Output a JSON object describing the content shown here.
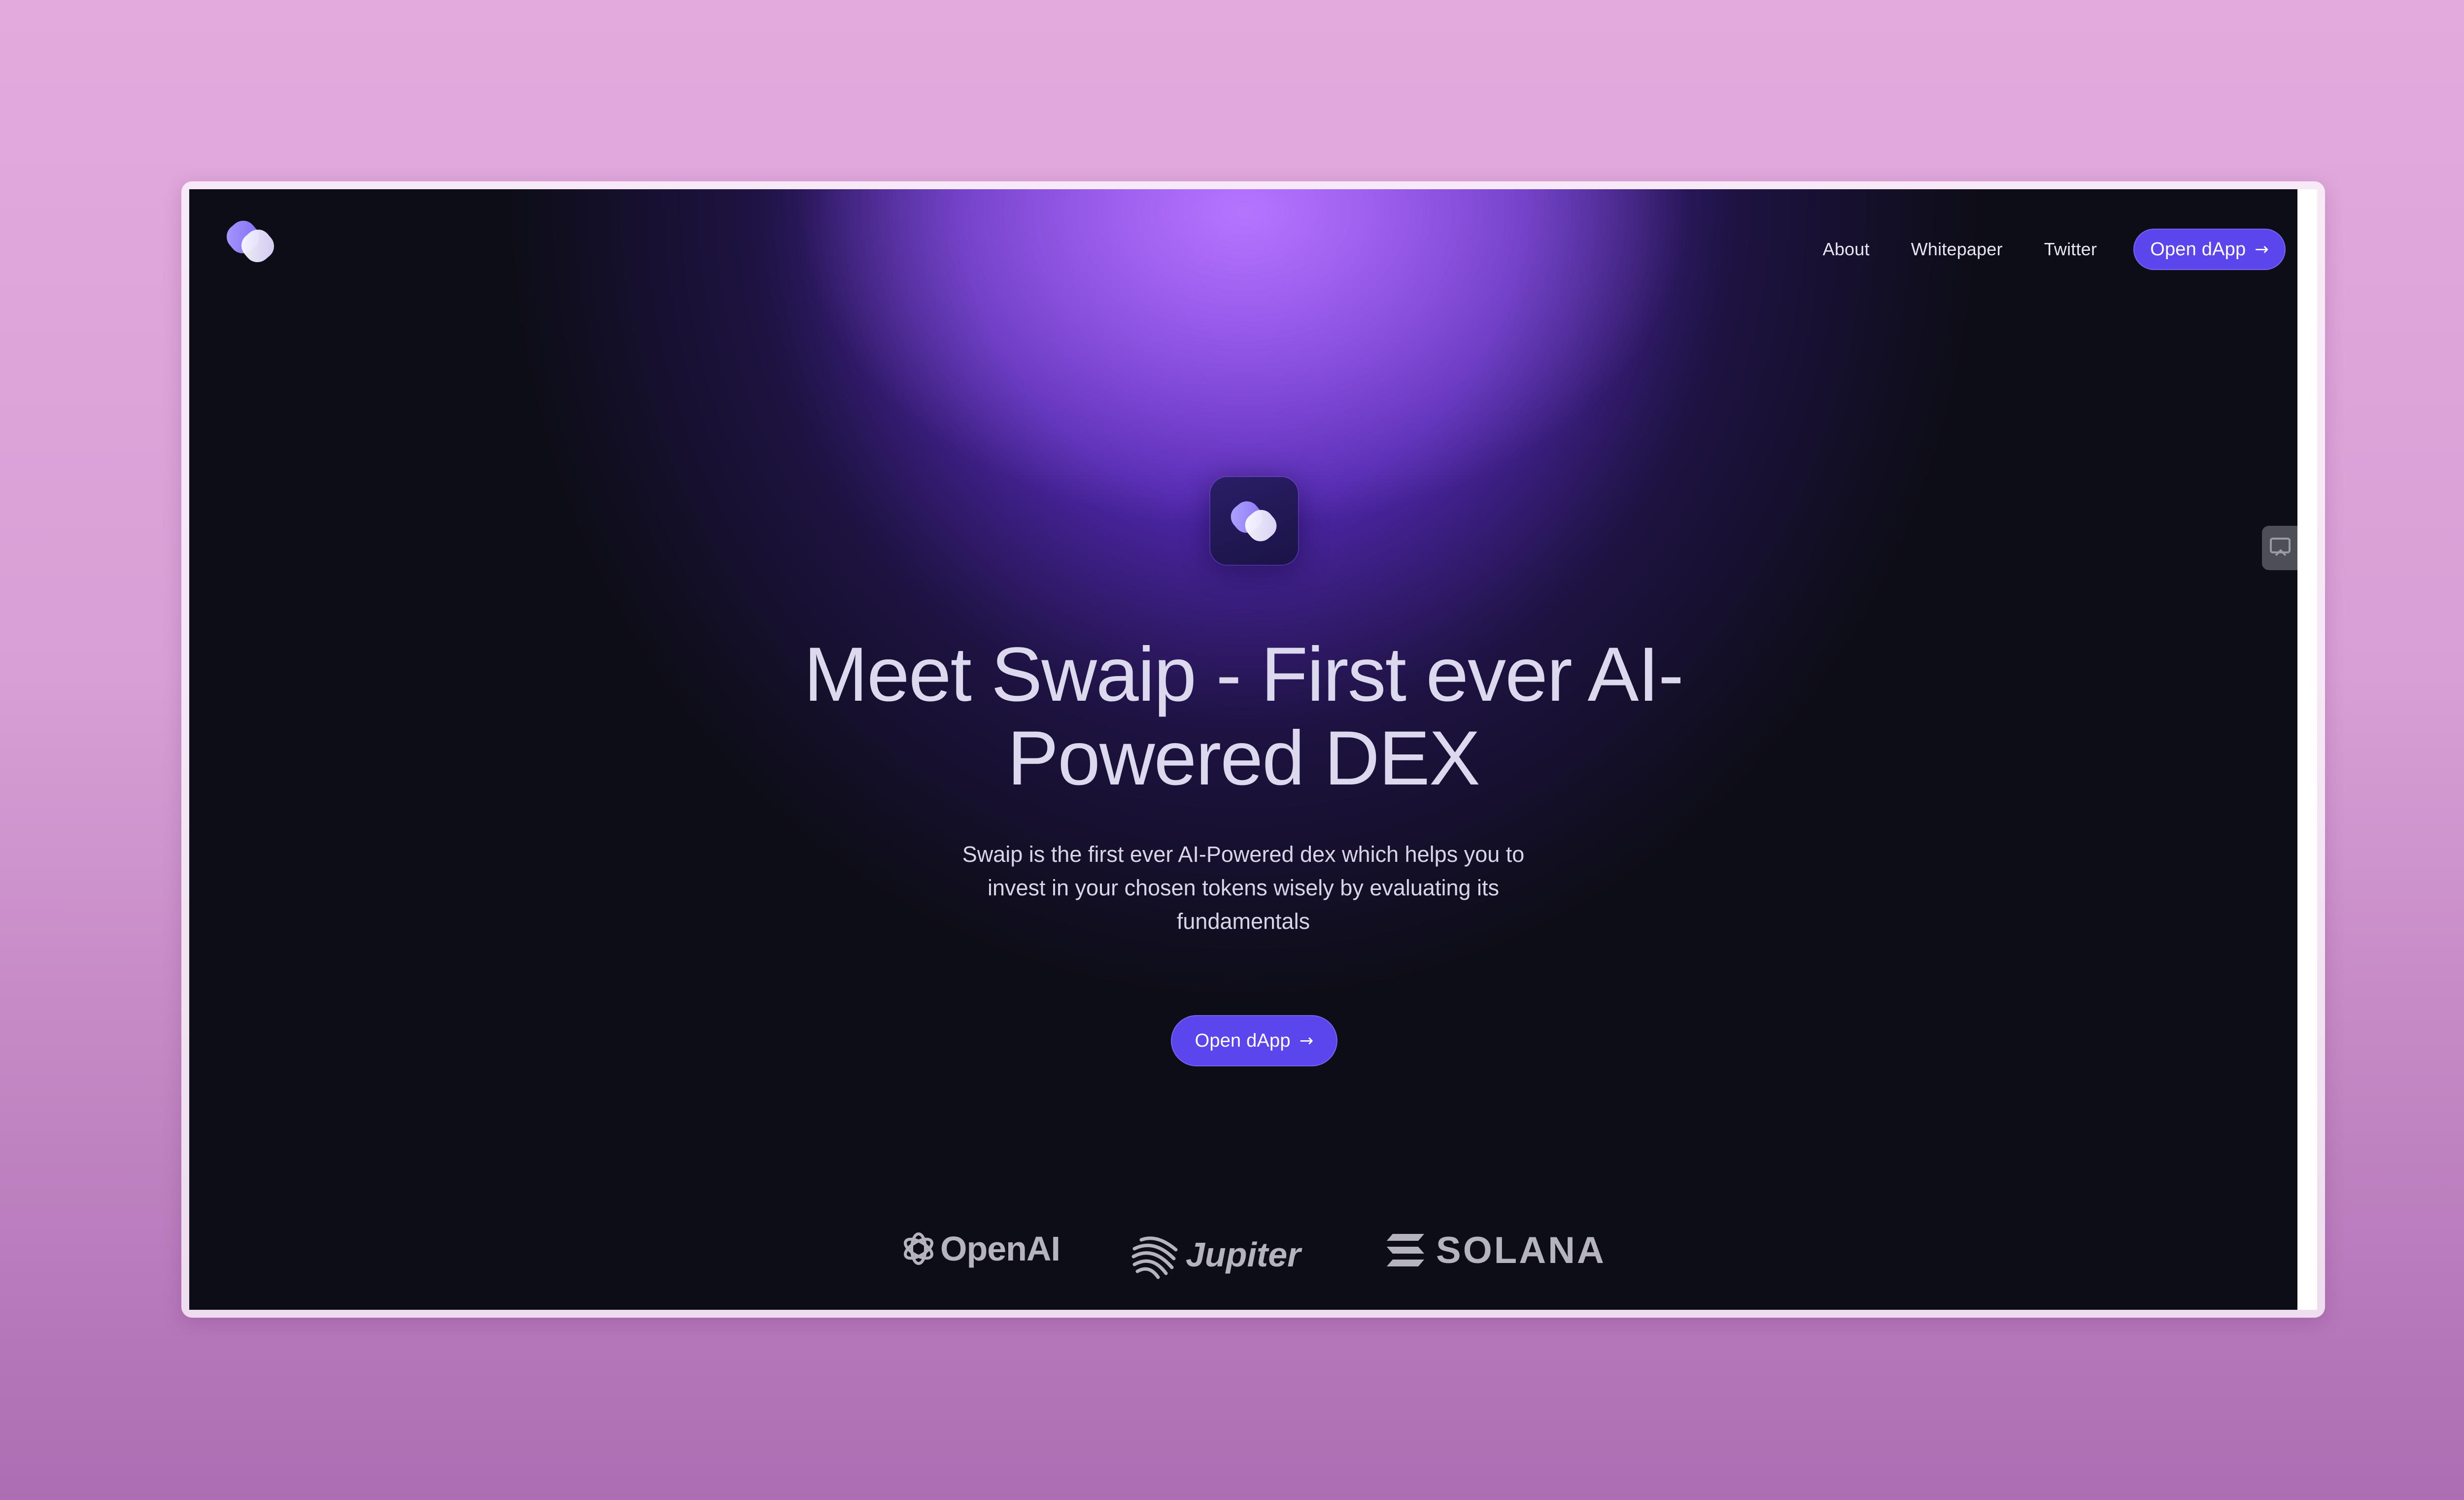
{
  "nav": {
    "logo": "swaip-logo-icon",
    "links": [
      "About",
      "Whitepaper",
      "Twitter"
    ],
    "cta_label": "Open dApp",
    "cta_icon": "arrow-right-icon"
  },
  "hero": {
    "app_icon": "swaip-app-icon",
    "title_line1": "Meet Swaip - First ever AI-",
    "title_line2": "Powered DEX",
    "subtitle": "Swaip is the first ever AI-Powered dex which helps you to invest in your chosen tokens wisely by evaluating its fundamentals",
    "cta_label": "Open dApp",
    "cta_icon": "arrow-right-icon"
  },
  "partners": [
    {
      "name": "OpenAI",
      "icon": "openai-logo-icon"
    },
    {
      "name": "Jupiter",
      "icon": "jupiter-logo-icon"
    },
    {
      "name": "SOLANA",
      "icon": "solana-logo-icon"
    }
  ],
  "side_widget": {
    "icon": "screen-capture-icon"
  },
  "colors": {
    "page_bg": "#0d0d16",
    "accent": "#5b46ee",
    "glow": "#7834ec",
    "outer_bg": "#dba3d7"
  }
}
